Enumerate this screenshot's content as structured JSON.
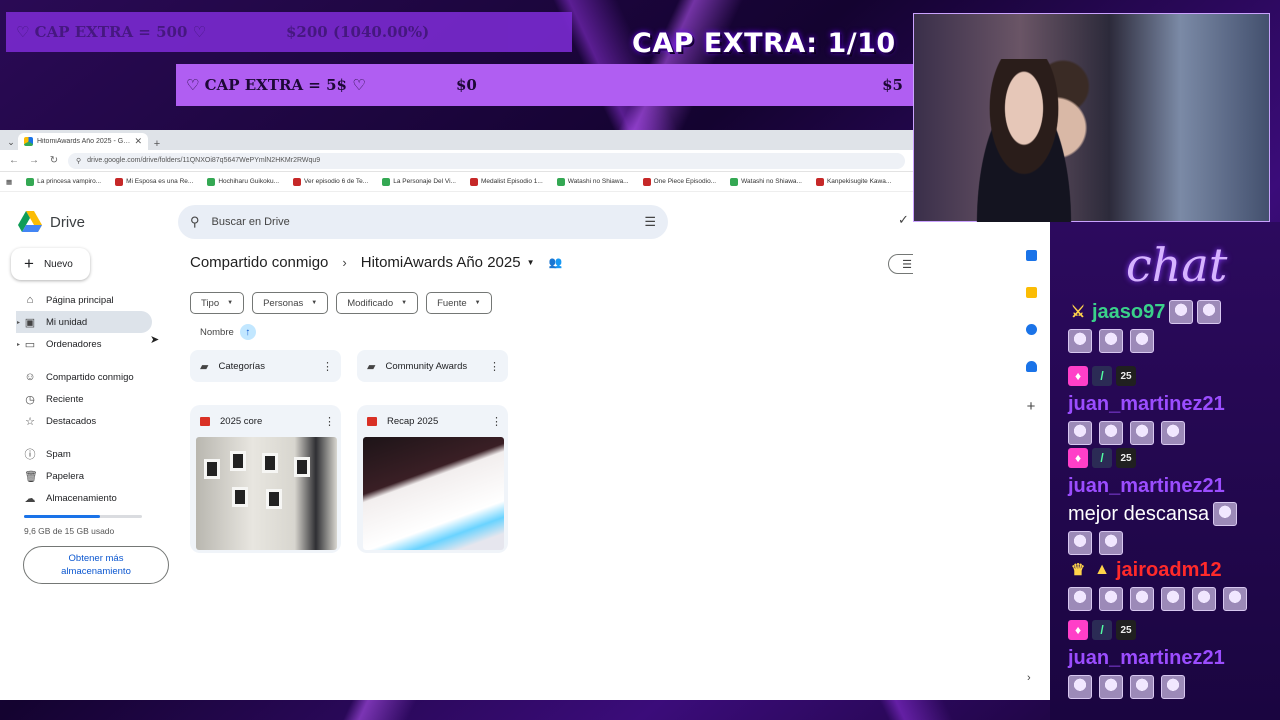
{
  "overlay": {
    "goal_top": {
      "label": "♡ CAP EXTRA = 500 ♡",
      "amount": "$200 (1040.00%)"
    },
    "goal_main": {
      "label": "♡ CAP EXTRA = 5$ ♡",
      "amount": "$0",
      "target": "$5"
    },
    "title": "CAP EXTRA: 1/10"
  },
  "chat": {
    "title": "chat",
    "messages": [
      {
        "user": "jaaso97",
        "color": "#3ad18a",
        "text": ""
      },
      {
        "user": "juan_martinez21",
        "color": "#9b4dff",
        "text": ""
      },
      {
        "user": "juan_martinez21",
        "color": "#9b4dff",
        "text": "mejor descansa"
      },
      {
        "user": "jairoadm12",
        "color": "#ff2a2a",
        "text": ""
      },
      {
        "user": "juan_martinez21",
        "color": "#9b4dff",
        "text": ""
      }
    ],
    "badge_num": "25"
  },
  "browser": {
    "tab_title": "HitomiAwards Año 2025 - Goo",
    "url": "drive.google.com/drive/folders/11QNXOi87q5647WePYmlN2HKMr2RWqu9",
    "bookmarks": [
      "La princesa vampiro...",
      "Mi Esposa es una Re...",
      "Hochiharu Guikoku...",
      "Ver episodio 6 de Te...",
      "La Personaje Del Vi...",
      "Medalist Episodio 1...",
      "Watashi no Shiawa...",
      "One Piece Episodio...",
      "Watashi no Shiawa...",
      "Kanpekisugite Kawa..."
    ]
  },
  "drive": {
    "logo": "Drive",
    "search_placeholder": "Buscar en Drive",
    "new_label": "Nuevo",
    "nav": [
      {
        "label": "Página principal",
        "icon": "home-icon"
      },
      {
        "label": "Mi unidad",
        "icon": "drive-icon"
      },
      {
        "label": "Ordenadores",
        "icon": "computer-icon"
      },
      {
        "label": "Compartido conmigo",
        "icon": "people-icon"
      },
      {
        "label": "Reciente",
        "icon": "clock-icon"
      },
      {
        "label": "Destacados",
        "icon": "star-icon"
      },
      {
        "label": "Spam",
        "icon": "spam-icon"
      },
      {
        "label": "Papelera",
        "icon": "trash-icon"
      },
      {
        "label": "Almacenamiento",
        "icon": "cloud-icon"
      }
    ],
    "storage": {
      "used_text": "9,6 GB de 15 GB usado",
      "fraction": 0.64,
      "button": "Obtener más almacenamiento"
    },
    "breadcrumb": {
      "parent": "Compartido conmigo",
      "current": "HitomiAwards Año 2025"
    },
    "filters": [
      "Tipo",
      "Personas",
      "Modificado",
      "Fuente"
    ],
    "sort_label": "Nombre",
    "folders": [
      "Categorías",
      "Community Awards"
    ],
    "files": [
      "2025 core",
      "Recap 2025"
    ]
  }
}
